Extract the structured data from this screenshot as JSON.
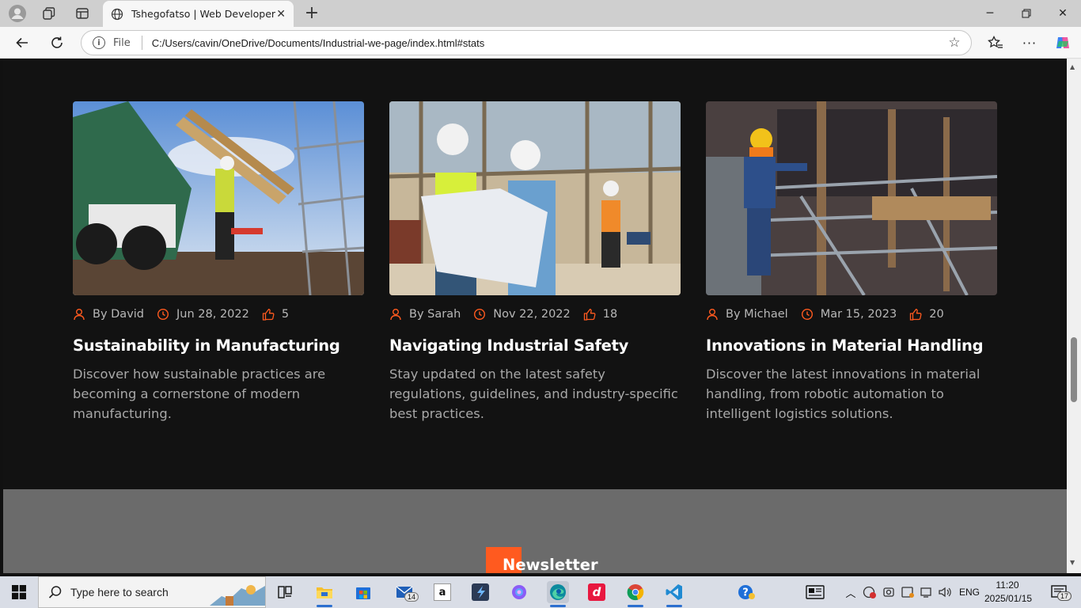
{
  "browser": {
    "tab_title": "Tshegofatso | Web Developer",
    "address_label": "File",
    "url": "C:/Users/cavin/OneDrive/Documents/Industrial-we-page/index.html#stats"
  },
  "blog": {
    "posts": [
      {
        "author": "By David",
        "date": "Jun 28, 2022",
        "likes": "5",
        "title": "Sustainability in Manufacturing",
        "excerpt": "Discover how sustainable practices are becoming a cornerstone of modern manufacturing."
      },
      {
        "author": "By Sarah",
        "date": "Nov 22, 2022",
        "likes": "18",
        "title": "Navigating Industrial Safety",
        "excerpt": "Stay updated on the latest safety regulations, guidelines, and industry-specific best practices."
      },
      {
        "author": "By Michael",
        "date": "Mar 15, 2023",
        "likes": "20",
        "title": "Innovations in Material Handling",
        "excerpt": "Discover the latest innovations in material handling, from robotic automation to intelligent logistics solutions."
      }
    ]
  },
  "newsletter": {
    "title": "Newsletter"
  },
  "colors": {
    "accent": "#ff5a1f",
    "page_bg": "#121212",
    "newsletter_bg": "#6b6b6b"
  },
  "taskbar": {
    "search_placeholder": "Type here to search",
    "mail_badge": "14",
    "language": "ENG",
    "time": "11:20",
    "date": "2025/01/15",
    "notification_count": "17"
  }
}
